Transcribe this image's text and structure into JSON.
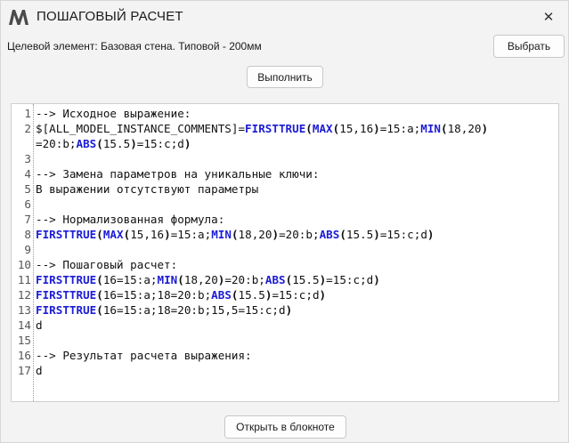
{
  "window": {
    "title": "ПОШАГОВЫЙ РАСЧЕТ",
    "close_glyph": "✕"
  },
  "target": {
    "label": "Целевой элемент: Базовая стена. Типовой - 200мм",
    "select_label": "Выбрать"
  },
  "run_label": "Выполнить",
  "notepad_label": "Открыть в блокноте",
  "colors": {
    "function": "#1c1cd6",
    "text": "#111111",
    "line_number": "#555555"
  },
  "editor": {
    "lines": [
      {
        "n": "1",
        "tokens": [
          {
            "t": "--> Исходное выражение:",
            "c": "txt"
          }
        ]
      },
      {
        "n": "2",
        "tokens": [
          {
            "t": "$[ALL_MODEL_INSTANCE_COMMENTS]=",
            "c": "txt"
          },
          {
            "t": "FIRSTTRUE",
            "c": "fn"
          },
          {
            "t": "(",
            "c": "par"
          },
          {
            "t": "MAX",
            "c": "fn"
          },
          {
            "t": "(",
            "c": "par"
          },
          {
            "t": "15,16",
            "c": "txt"
          },
          {
            "t": ")",
            "c": "par"
          },
          {
            "t": "=15:a;",
            "c": "txt"
          },
          {
            "t": "MIN",
            "c": "fn"
          },
          {
            "t": "(",
            "c": "par"
          },
          {
            "t": "18,20",
            "c": "txt"
          },
          {
            "t": ")",
            "c": "par"
          }
        ]
      },
      {
        "n": "",
        "tokens": [
          {
            "t": "=20:b;",
            "c": "txt"
          },
          {
            "t": "ABS",
            "c": "fn"
          },
          {
            "t": "(",
            "c": "par"
          },
          {
            "t": "15.5",
            "c": "txt"
          },
          {
            "t": ")",
            "c": "par"
          },
          {
            "t": "=15:c;d",
            "c": "txt"
          },
          {
            "t": ")",
            "c": "par"
          }
        ]
      },
      {
        "n": "3",
        "tokens": []
      },
      {
        "n": "4",
        "tokens": [
          {
            "t": "--> Замена параметров на уникальные ключи:",
            "c": "txt"
          }
        ]
      },
      {
        "n": "5",
        "tokens": [
          {
            "t": "В выражении отсутствуют параметры",
            "c": "txt"
          }
        ]
      },
      {
        "n": "6",
        "tokens": []
      },
      {
        "n": "7",
        "tokens": [
          {
            "t": "--> Нормализованная формула:",
            "c": "txt"
          }
        ]
      },
      {
        "n": "8",
        "tokens": [
          {
            "t": "FIRSTTRUE",
            "c": "fn"
          },
          {
            "t": "(",
            "c": "par"
          },
          {
            "t": "MAX",
            "c": "fn"
          },
          {
            "t": "(",
            "c": "par"
          },
          {
            "t": "15,16",
            "c": "txt"
          },
          {
            "t": ")",
            "c": "par"
          },
          {
            "t": "=15:a;",
            "c": "txt"
          },
          {
            "t": "MIN",
            "c": "fn"
          },
          {
            "t": "(",
            "c": "par"
          },
          {
            "t": "18,20",
            "c": "txt"
          },
          {
            "t": ")",
            "c": "par"
          },
          {
            "t": "=20:b;",
            "c": "txt"
          },
          {
            "t": "ABS",
            "c": "fn"
          },
          {
            "t": "(",
            "c": "par"
          },
          {
            "t": "15.5",
            "c": "txt"
          },
          {
            "t": ")",
            "c": "par"
          },
          {
            "t": "=15:c;d",
            "c": "txt"
          },
          {
            "t": ")",
            "c": "par"
          }
        ]
      },
      {
        "n": "9",
        "tokens": []
      },
      {
        "n": "10",
        "tokens": [
          {
            "t": "--> Пошаговый расчет:",
            "c": "txt"
          }
        ]
      },
      {
        "n": "11",
        "tokens": [
          {
            "t": "FIRSTTRUE",
            "c": "fn"
          },
          {
            "t": "(",
            "c": "par"
          },
          {
            "t": "16=15:a;",
            "c": "txt"
          },
          {
            "t": "MIN",
            "c": "fn"
          },
          {
            "t": "(",
            "c": "par"
          },
          {
            "t": "18,20",
            "c": "txt"
          },
          {
            "t": ")",
            "c": "par"
          },
          {
            "t": "=20:b;",
            "c": "txt"
          },
          {
            "t": "ABS",
            "c": "fn"
          },
          {
            "t": "(",
            "c": "par"
          },
          {
            "t": "15.5",
            "c": "txt"
          },
          {
            "t": ")",
            "c": "par"
          },
          {
            "t": "=15:c;d",
            "c": "txt"
          },
          {
            "t": ")",
            "c": "par"
          }
        ]
      },
      {
        "n": "12",
        "tokens": [
          {
            "t": "FIRSTTRUE",
            "c": "fn"
          },
          {
            "t": "(",
            "c": "par"
          },
          {
            "t": "16=15:a;18=20:b;",
            "c": "txt"
          },
          {
            "t": "ABS",
            "c": "fn"
          },
          {
            "t": "(",
            "c": "par"
          },
          {
            "t": "15.5",
            "c": "txt"
          },
          {
            "t": ")",
            "c": "par"
          },
          {
            "t": "=15:c;d",
            "c": "txt"
          },
          {
            "t": ")",
            "c": "par"
          }
        ]
      },
      {
        "n": "13",
        "tokens": [
          {
            "t": "FIRSTTRUE",
            "c": "fn"
          },
          {
            "t": "(",
            "c": "par"
          },
          {
            "t": "16=15:a;18=20:b;15,5=15:c;d",
            "c": "txt"
          },
          {
            "t": ")",
            "c": "par"
          }
        ]
      },
      {
        "n": "14",
        "tokens": [
          {
            "t": "d",
            "c": "txt"
          }
        ]
      },
      {
        "n": "15",
        "tokens": []
      },
      {
        "n": "16",
        "tokens": [
          {
            "t": "--> Результат расчета выражения:",
            "c": "txt"
          }
        ]
      },
      {
        "n": "17",
        "tokens": [
          {
            "t": "d",
            "c": "txt"
          }
        ]
      }
    ]
  }
}
